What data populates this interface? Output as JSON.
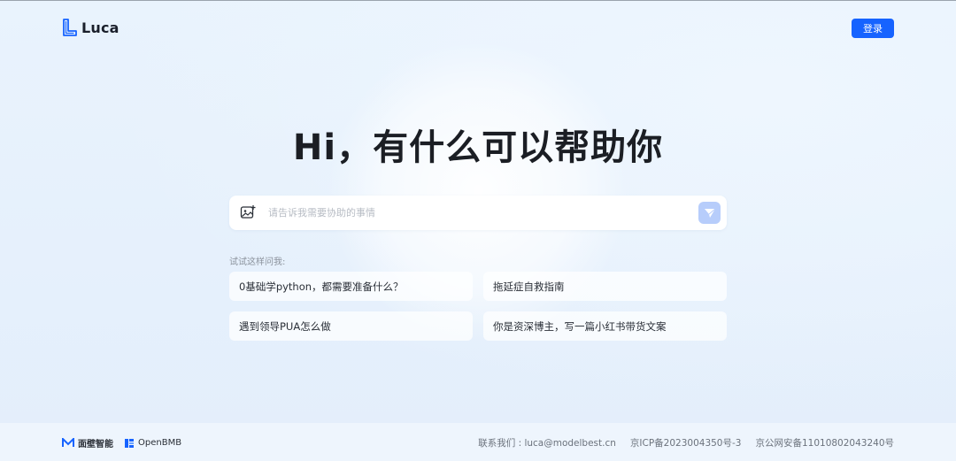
{
  "colors": {
    "primary": "#1663ff",
    "send_button_disabled": "#b7cdfb",
    "background": "#e6f1fc"
  },
  "header": {
    "logo_text": "Luca",
    "logo_icon": "luca-logo-icon",
    "login_label": "登录"
  },
  "hero": {
    "headline": "Hi，有什么可以帮助你"
  },
  "search": {
    "placeholder": "请告诉我需要协助的事情",
    "value": "",
    "upload_icon": "image-upload-icon",
    "send_icon": "send-icon"
  },
  "suggestions": {
    "label": "试试这样问我:",
    "items": [
      "0基础学python，都需要准备什么？",
      "拖延症自救指南",
      "遇到领导PUA怎么做",
      "你是资深博主，写一篇小红书带货文案"
    ]
  },
  "footer": {
    "brand_1": "面壁智能",
    "brand_2": "OpenBMB",
    "contact": "联系我们 : luca@modelbest.cn",
    "icp": "京ICP备2023004350号-3",
    "police": "京公网安备11010802043240号"
  }
}
